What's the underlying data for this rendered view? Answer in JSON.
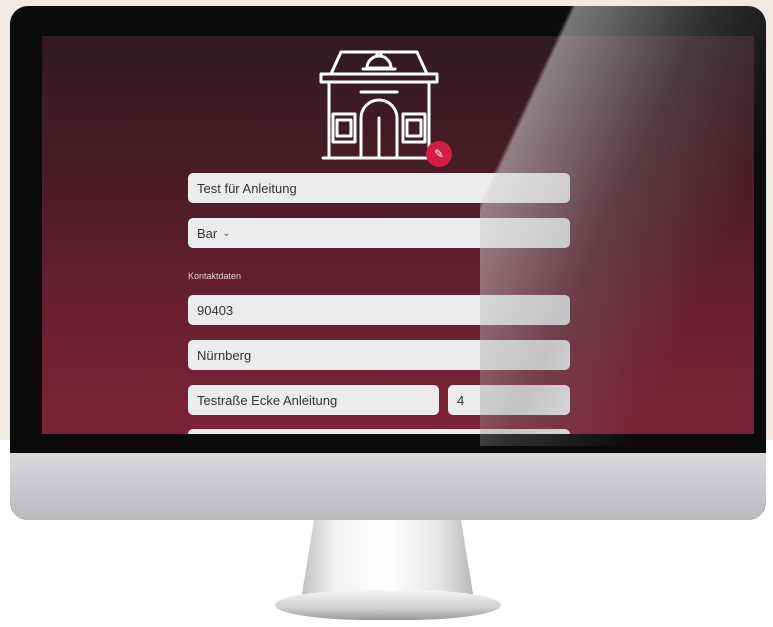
{
  "form": {
    "name_value": "Test für Anleitung",
    "category_selected": "Bar",
    "section_label": "Kontaktdaten",
    "zip_value": "90403",
    "city_value": "Nürnberg",
    "street_value": "Testraße Ecke Anleitung",
    "house_number_value": "4"
  },
  "icons": {
    "logo": "restaurant-building-icon",
    "edit": "pencil-icon",
    "dropdown": "chevron-down-icon"
  },
  "colors": {
    "accent": "#d21e45",
    "field_background": "#ececef",
    "screen_gradient_top": "#2f1a20",
    "screen_gradient_bottom": "#7d2239"
  }
}
